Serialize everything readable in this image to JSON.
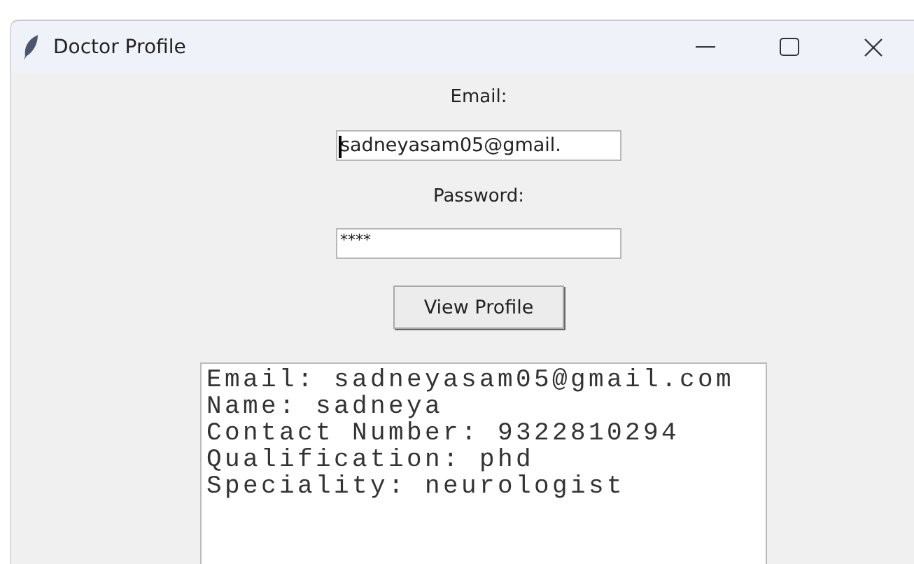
{
  "window": {
    "title": "Doctor Profile"
  },
  "form": {
    "email_label": "Email:",
    "email_value": "sadneyasam05@gmail.",
    "email_focused": true,
    "password_label": "Password:",
    "password_value": "****",
    "button": "View Profile"
  },
  "output": {
    "lines": [
      "Email: sadneyasam05@gmail.com",
      "Name: sadneya",
      "Contact Number: 9322810294",
      "Qualification: phd",
      "Speciality: neurologist"
    ]
  }
}
